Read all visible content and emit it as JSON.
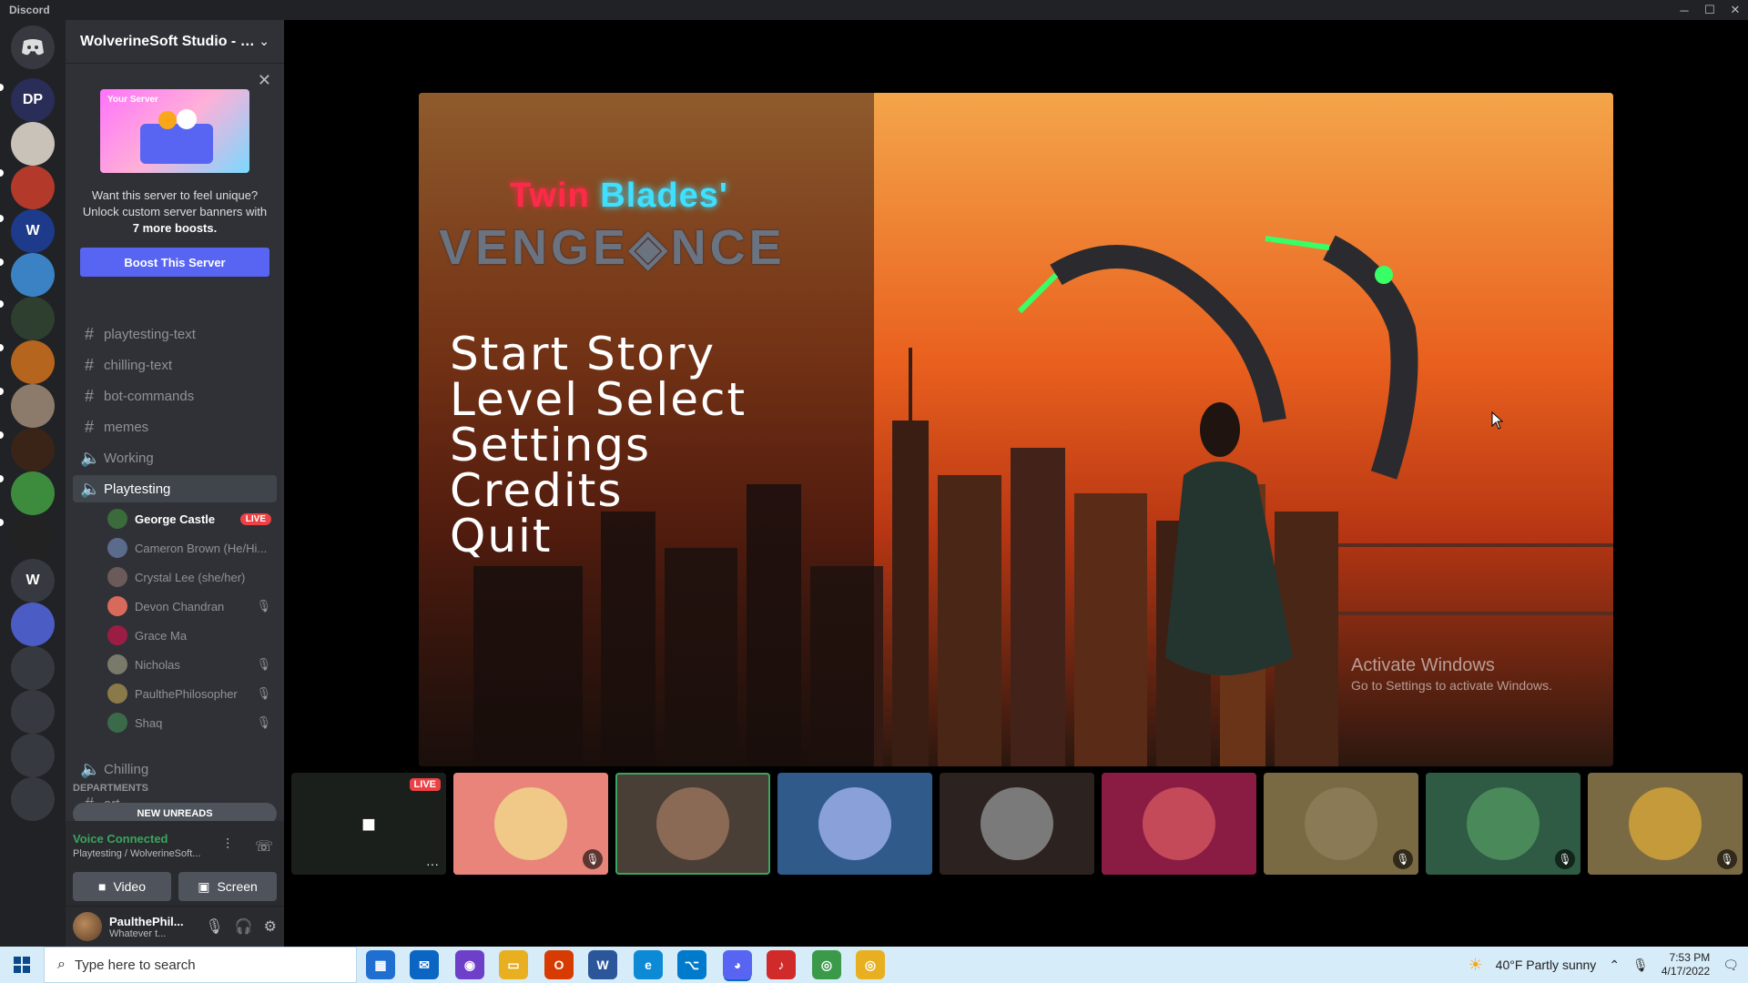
{
  "window": {
    "title": "Discord",
    "minimize": "─",
    "maximize": "☐",
    "close": "✕"
  },
  "server": {
    "name": "WolverineSoft Studio - P...",
    "chevron": "⌄"
  },
  "rail": {
    "items": [
      {
        "label": "DP",
        "color": "#2b2d59",
        "icon": "dp-server-icon"
      },
      {
        "label": "",
        "color": "#c9c2b8",
        "icon": "cat-server-icon"
      },
      {
        "label": "",
        "color": "#b33a2a",
        "icon": "cube-server-icon"
      },
      {
        "label": "W",
        "color": "#1e3a8a",
        "icon": "wolverine-server-icon"
      },
      {
        "label": "",
        "color": "#3b82c4",
        "icon": "cat-blue-server-icon"
      },
      {
        "label": "",
        "color": "#2f3f2f",
        "icon": "game-server-icon"
      },
      {
        "label": "",
        "color": "#b5651d",
        "icon": "bloons-server-icon"
      },
      {
        "label": "",
        "color": "#8c7b6b",
        "icon": "avatar-server-icon"
      },
      {
        "label": "",
        "color": "#3a2418",
        "icon": "bloon-td-server-icon"
      },
      {
        "label": "",
        "color": "#3d8c3d",
        "icon": "pixel-server-icon"
      },
      {
        "label": "",
        "color": "#222",
        "icon": "compass-server-icon"
      },
      {
        "label": "W",
        "color": "#36393f",
        "icon": "w-server-icon"
      },
      {
        "label": "",
        "color": "#4b5cc4",
        "icon": "folder-server-icon"
      },
      {
        "label": "",
        "color": "#36393f",
        "icon": "folder2-server-icon"
      },
      {
        "label": "",
        "color": "#36393f",
        "icon": "folder3-server-icon"
      },
      {
        "label": "",
        "color": "#36393f",
        "icon": "folder4-server-icon"
      },
      {
        "label": "",
        "color": "#36393f",
        "icon": "folder5-server-icon"
      }
    ]
  },
  "boost": {
    "banner_label": "Your Server",
    "text_line": "Want this server to feel unique? Unlock custom server banners with",
    "text_bold": "7 more boosts.",
    "button": "Boost This Server",
    "close": "✕"
  },
  "channels": {
    "text": [
      {
        "name": "playtesting-text",
        "glyph": "#"
      },
      {
        "name": "chilling-text",
        "glyph": "#"
      },
      {
        "name": "bot-commands",
        "glyph": "#"
      },
      {
        "name": "memes",
        "glyph": "#"
      }
    ],
    "voice_working": "Working",
    "voice_playtesting": "Playtesting",
    "voice_chilling": "Chilling",
    "speaker_glyph": "🔈",
    "category": "DEPARTMENTS",
    "art": "art",
    "new_unreads": "NEW UNREADS"
  },
  "voice_users": [
    {
      "name": "George Castle",
      "live": "LIVE",
      "muted": false,
      "color": "#3b6b3b",
      "bright": true
    },
    {
      "name": "Cameron Brown (He/Hi...",
      "live": "",
      "muted": false,
      "color": "#5b6b8c",
      "bright": false
    },
    {
      "name": "Crystal Lee (she/her)",
      "live": "",
      "muted": false,
      "color": "#6b5a5a",
      "bright": false
    },
    {
      "name": "Devon Chandran",
      "live": "",
      "muted": true,
      "color": "#d86a5c",
      "bright": false
    },
    {
      "name": "Grace Ma",
      "live": "",
      "muted": false,
      "color": "#9c1d44",
      "bright": false
    },
    {
      "name": "Nicholas",
      "live": "",
      "muted": true,
      "color": "#7a7a6a",
      "bright": false
    },
    {
      "name": "PaulthePhilosopher",
      "live": "",
      "muted": true,
      "color": "#8a7a4a",
      "bright": false
    },
    {
      "name": "Shaq",
      "live": "",
      "muted": true,
      "color": "#3a6a4a",
      "bright": false
    }
  ],
  "voice_panel": {
    "status": "Voice Connected",
    "sub": "Playtesting / WolverineSoft...",
    "video": "Video",
    "screen": "Screen"
  },
  "user": {
    "name": "PaulthePhil...",
    "status": "Whatever t..."
  },
  "game": {
    "title_part1": "Twin",
    "title_part2": "Blades'",
    "title_line2": "VENGE◈NCE",
    "menu": [
      "Start Story",
      "Level Select",
      "Settings",
      "Credits",
      "Quit"
    ]
  },
  "watermark": {
    "line1": "Activate Windows",
    "line2": "Go to Settings to activate Windows."
  },
  "tiles": [
    {
      "kind": "stream",
      "bg": "#1b1f1b",
      "live": "LIVE",
      "more": "···"
    },
    {
      "kind": "user",
      "bg": "#e8847a",
      "avatar": "#f0c888",
      "muted": true,
      "speaking": false
    },
    {
      "kind": "user",
      "bg": "#4a3f37",
      "avatar": "#8a6a55",
      "muted": false,
      "speaking": true
    },
    {
      "kind": "user",
      "bg": "#2f5a8a",
      "avatar": "#8aa0d8",
      "muted": false,
      "speaking": false
    },
    {
      "kind": "user",
      "bg": "#2c2220",
      "avatar": "#7a7a7a",
      "muted": false,
      "speaking": false
    },
    {
      "kind": "user",
      "bg": "#8a1c44",
      "avatar": "#c44a5a",
      "muted": false,
      "speaking": false
    },
    {
      "kind": "user",
      "bg": "#7a6a44",
      "avatar": "#8a7a55",
      "muted": true,
      "speaking": false
    },
    {
      "kind": "user",
      "bg": "#2f5a44",
      "avatar": "#4a8a5a",
      "muted": true,
      "speaking": false
    },
    {
      "kind": "user",
      "bg": "#7a6a44",
      "avatar": "#c49a3a",
      "muted": true,
      "speaking": false
    }
  ],
  "taskbar": {
    "search_placeholder": "Type here to search",
    "apps": [
      {
        "name": "store-app",
        "color": "#1f6fd1",
        "label": "▦"
      },
      {
        "name": "mail-app",
        "color": "#0a66c2",
        "label": "✉"
      },
      {
        "name": "github-app",
        "color": "#6e40c9",
        "label": "◉"
      },
      {
        "name": "files-app",
        "color": "#e8b021",
        "label": "▭"
      },
      {
        "name": "office-app",
        "color": "#d83b01",
        "label": "O"
      },
      {
        "name": "word-app",
        "color": "#2b579a",
        "label": "W"
      },
      {
        "name": "edge-app",
        "color": "#0c8ad6",
        "label": "e"
      },
      {
        "name": "vscode-app",
        "color": "#007acc",
        "label": "⌥"
      },
      {
        "name": "discord-app",
        "color": "#5865f2",
        "label": "◕"
      },
      {
        "name": "music-app",
        "color": "#d12a2a",
        "label": "♪"
      },
      {
        "name": "chrome-app",
        "color": "#3a9a4a",
        "label": "◎"
      },
      {
        "name": "chrome2-app",
        "color": "#e8b021",
        "label": "◎"
      }
    ],
    "weather": "40°F  Partly sunny",
    "time": "7:53 PM",
    "date": "4/17/2022",
    "notification": "🗨"
  }
}
